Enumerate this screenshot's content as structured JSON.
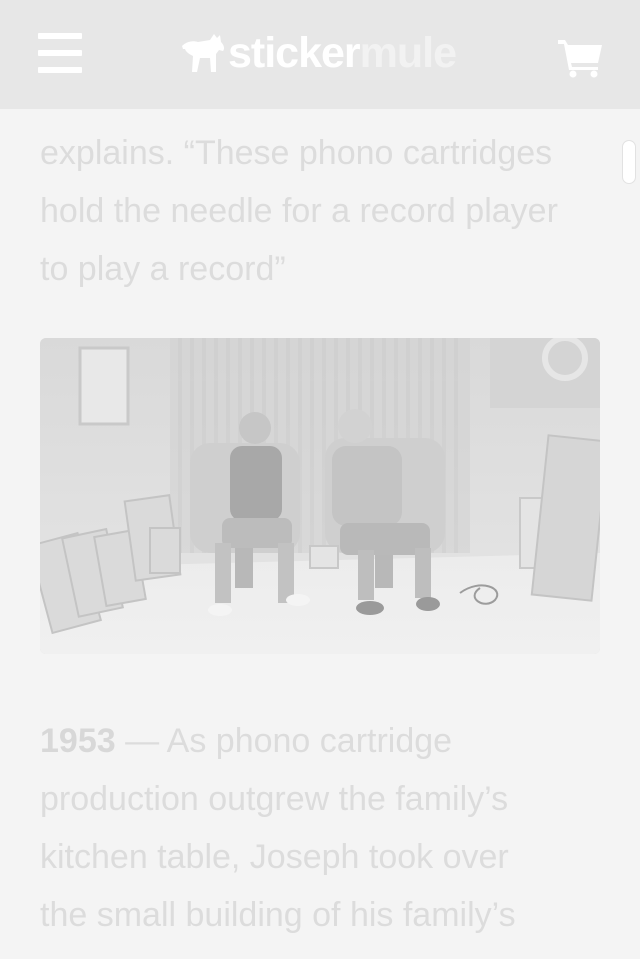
{
  "header": {
    "logo_primary": "sticker",
    "logo_secondary": "mule",
    "menu_icon": "hamburger-menu-icon",
    "cart_icon": "shopping-cart-icon",
    "logo_icon": "mule-logo-icon"
  },
  "article": {
    "paragraph_top_lines": [
      "explains. “These phono cartridges",
      "hold the needle for a record player",
      "to play a record”"
    ],
    "photo_description_name": "studio-photo",
    "paragraph_bottom": {
      "year": "1953",
      "dash": " — ",
      "lines": [
        "As phono cartridge",
        "production outgrew the family’s",
        "kitchen table, Joseph took over",
        "the small building of his family’s"
      ]
    }
  },
  "colors": {
    "header_bg": "#e7e7e7",
    "page_bg": "#f4f4f4",
    "text": "#dcdcdc"
  }
}
